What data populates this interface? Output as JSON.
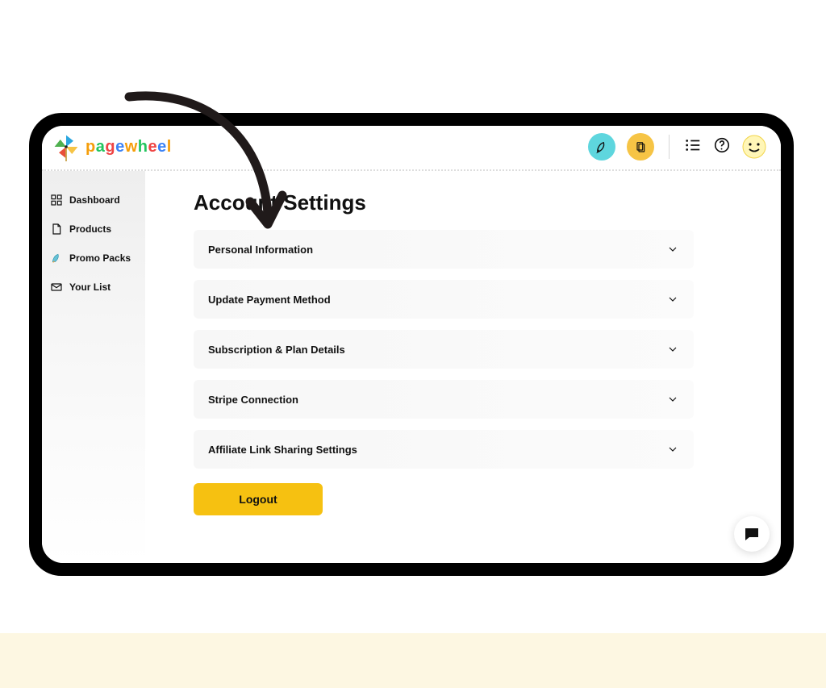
{
  "brand": {
    "name": "pagewheel"
  },
  "sidebar": {
    "items": [
      {
        "label": "Dashboard",
        "icon": "grid-icon"
      },
      {
        "label": "Products",
        "icon": "file-icon"
      },
      {
        "label": "Promo Packs",
        "icon": "rocket-icon"
      },
      {
        "label": "Your List",
        "icon": "mail-icon"
      }
    ]
  },
  "header_actions": {
    "rocket": "rocket-icon",
    "copy": "copy-icon",
    "list": "list-icon",
    "help": "help-icon",
    "avatar": "smiley-avatar"
  },
  "page": {
    "title": "Account Settings",
    "sections": [
      {
        "label": "Personal Information"
      },
      {
        "label": "Update Payment Method"
      },
      {
        "label": "Subscription & Plan Details"
      },
      {
        "label": "Stripe Connection"
      },
      {
        "label": "Affiliate Link Sharing Settings"
      }
    ],
    "logout_label": "Logout"
  },
  "colors": {
    "accent_yellow": "#f6c111",
    "accent_teal": "#5ed6de"
  }
}
